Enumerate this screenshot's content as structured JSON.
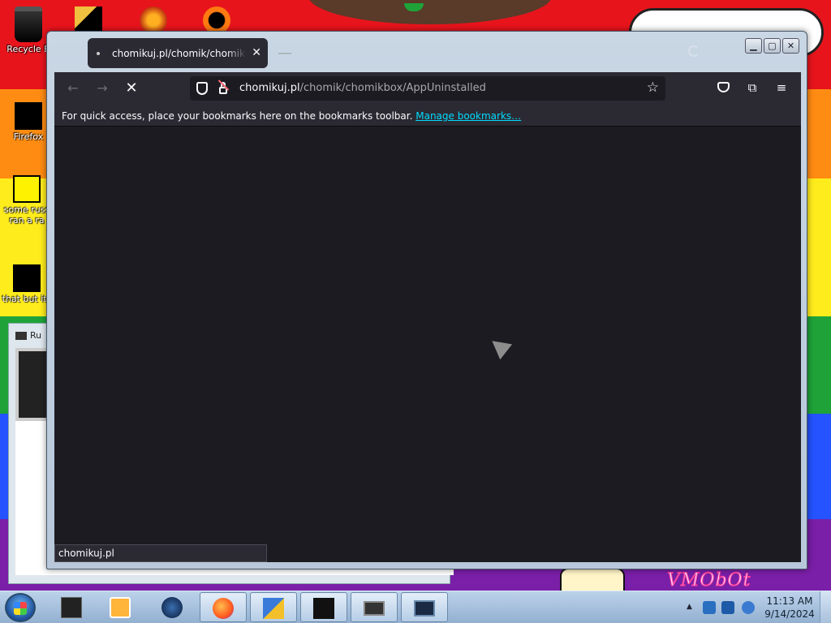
{
  "desktop": {
    "icons": {
      "recycle_bin": "Recycle B",
      "firefox": "Firefox",
      "russian_1": "some russ",
      "russian_2": "ran a ra",
      "thatbut": "that but its"
    },
    "art_text": "VMObOt"
  },
  "back_window": {
    "title": "Ru"
  },
  "browser": {
    "tab": {
      "title": "chomikuj.pl/chomik/chomikbox/AppUninstalled",
      "close": "✕"
    },
    "newtab_symbol": "—",
    "window_controls": {
      "minimize": "▁",
      "maximize": "▢",
      "close": "✕"
    },
    "nav": {
      "back": "←",
      "forward": "→",
      "stop": "✕"
    },
    "urlbar": {
      "domain": "chomikuj.pl",
      "path": "/chomik/chomikbox/AppUninstalled",
      "star": "☆"
    },
    "toolbar_icons": {
      "pocket": "pocket-icon",
      "extensions": "⧉",
      "menu": "≡"
    },
    "bookmarks_bar": {
      "text": "For quick access, place your bookmarks here on the bookmarks toolbar.",
      "link": "Manage bookmarks…"
    },
    "status_text": "chomikuj.pl"
  },
  "taskbar": {
    "clock": {
      "time": "11:13 AM",
      "date": "9/14/2024"
    },
    "tray_expand": "▲"
  },
  "colors": {
    "browser_chrome": "#2b2a33",
    "content_bg": "#1c1b22",
    "link": "#00ddff",
    "taskbar": "#93b0d0"
  }
}
